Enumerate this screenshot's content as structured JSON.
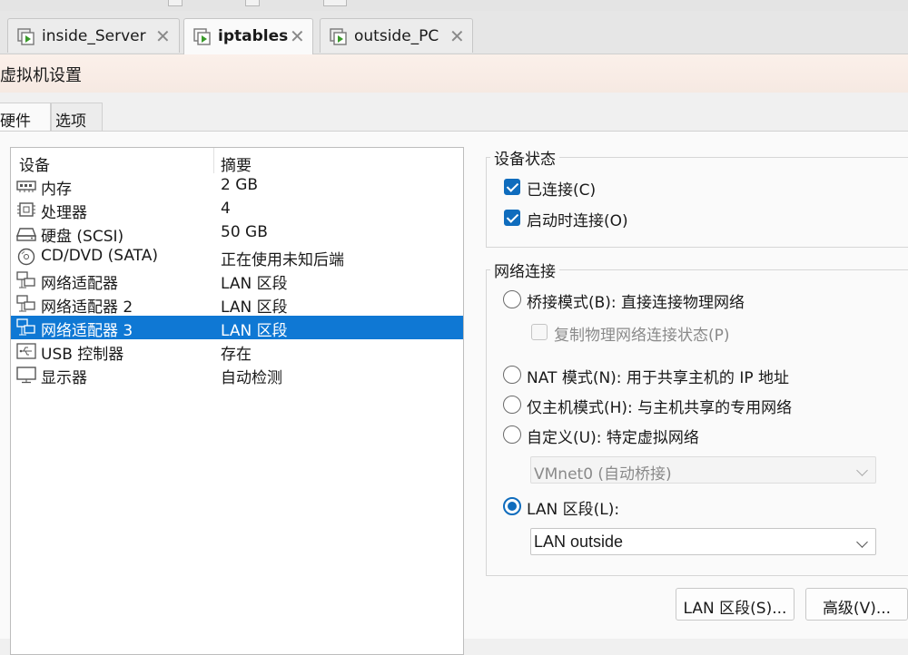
{
  "vm_tabs": [
    {
      "label": "inside_Server",
      "active": false
    },
    {
      "label": "iptables",
      "active": true
    },
    {
      "label": "outside_PC",
      "active": false
    }
  ],
  "window_title": "虚拟机设置",
  "settings_tabs": [
    "硬件",
    "选项"
  ],
  "device_table": {
    "headers": [
      "设备",
      "摘要"
    ],
    "rows": [
      {
        "icon": "memory-icon",
        "device": "内存",
        "summary": "2 GB"
      },
      {
        "icon": "processor-icon",
        "device": "处理器",
        "summary": "4"
      },
      {
        "icon": "hard-disk-icon",
        "device": "硬盘 (SCSI)",
        "summary": "50 GB"
      },
      {
        "icon": "cd-dvd-icon",
        "device": "CD/DVD (SATA)",
        "summary": "正在使用未知后端"
      },
      {
        "icon": "network-adapter-icon",
        "device": "网络适配器",
        "summary": "LAN 区段"
      },
      {
        "icon": "network-adapter-icon",
        "device": "网络适配器 2",
        "summary": "LAN 区段"
      },
      {
        "icon": "network-adapter-icon",
        "device": "网络适配器 3",
        "summary": "LAN 区段",
        "selected": true
      },
      {
        "icon": "usb-icon",
        "device": "USB 控制器",
        "summary": "存在"
      },
      {
        "icon": "display-icon",
        "device": "显示器",
        "summary": "自动检测"
      }
    ]
  },
  "device_status": {
    "title": "设备状态",
    "connected_label": "已连接(C)",
    "connected": true,
    "connect_at_power_on_label": "启动时连接(O)",
    "connect_at_power_on": true
  },
  "network_connection": {
    "title": "网络连接",
    "bridged_label": "桥接模式(B): 直接连接物理网络",
    "replicate_label": "复制物理网络连接状态(P)",
    "nat_label": "NAT 模式(N): 用于共享主机的 IP 地址",
    "host_only_label": "仅主机模式(H): 与主机共享的专用网络",
    "custom_label": "自定义(U): 特定虚拟网络",
    "custom_network_value": "VMnet0 (自动桥接)",
    "lan_segment_label": "LAN 区段(L):",
    "lan_segment_value": "LAN outside",
    "selected": "lan_segment"
  },
  "buttons": {
    "lan_segments": "LAN 区段(S)...",
    "advanced": "高级(V)..."
  },
  "colors": {
    "selection": "#0f78d4",
    "checkbox_accent": "#0f6cbd",
    "vm_play_icon": "#3a9a2a"
  }
}
